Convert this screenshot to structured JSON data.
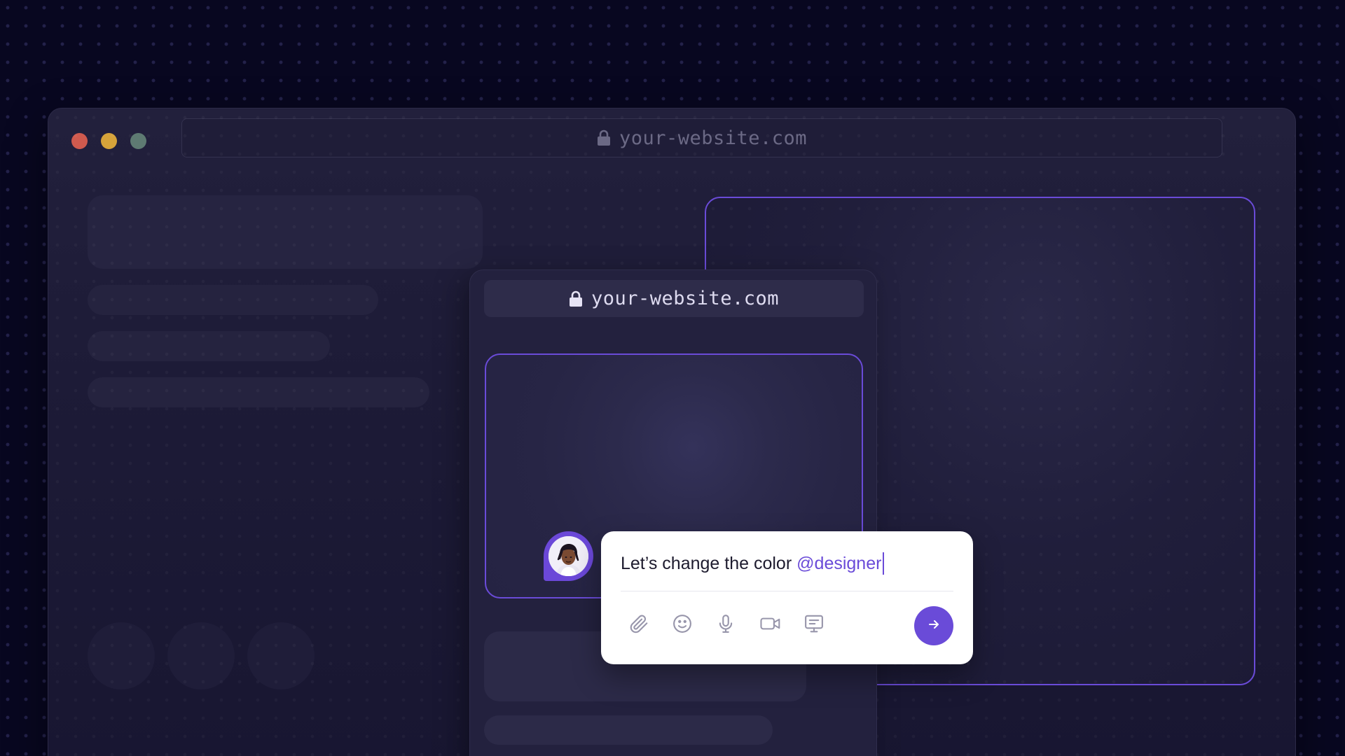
{
  "colors": {
    "accent": "#6a4bd8",
    "background": "#080720",
    "window": "#1d1b37",
    "traffic_red": "#cf5a4e",
    "traffic_yellow": "#d6a33a",
    "traffic_green": "#5e7a72"
  },
  "outer_browser": {
    "url": "your-website.com",
    "url_icon": "lock-icon"
  },
  "inner_browser": {
    "url": "your-website.com",
    "url_icon": "lock-icon"
  },
  "chat": {
    "message_text": "Let’s change the color",
    "mention": "@designer",
    "toolbar": [
      {
        "icon": "paperclip-icon"
      },
      {
        "icon": "smiley-icon"
      },
      {
        "icon": "microphone-icon"
      },
      {
        "icon": "video-camera-icon"
      },
      {
        "icon": "screen-share-icon"
      }
    ],
    "send_icon": "arrow-right-icon",
    "avatar": "user-avatar"
  }
}
